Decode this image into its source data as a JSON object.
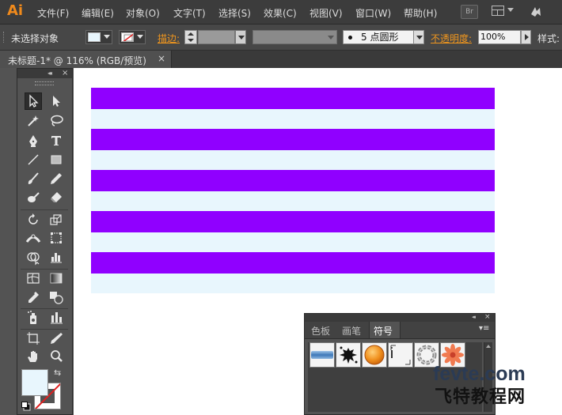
{
  "app": {
    "logo": "Ai"
  },
  "menu": {
    "items": [
      {
        "label": "文件(F)"
      },
      {
        "label": "编辑(E)"
      },
      {
        "label": "对象(O)"
      },
      {
        "label": "文字(T)"
      },
      {
        "label": "选择(S)"
      },
      {
        "label": "效果(C)"
      },
      {
        "label": "视图(V)"
      },
      {
        "label": "窗口(W)"
      },
      {
        "label": "帮助(H)"
      }
    ],
    "bridge_label": "Br",
    "workspace_icon": "workspace-grid-icon",
    "sync_icon": "creative-cloud-sync-icon"
  },
  "control_bar": {
    "selection_label": "未选择对象",
    "fill_color": "#e8f6fd",
    "stroke_icon": "none-stroke-icon",
    "stroke_label": "描边:",
    "brush_label": "5 点圆形",
    "opacity_label": "不透明度:",
    "opacity_value": "100%",
    "style_label": "样式:"
  },
  "document": {
    "tab_title": "未标题-1* @ 116% (RGB/预览)",
    "close": "×"
  },
  "artwork": {
    "stripe_colors": [
      "#9000ff",
      "#e8f6fd"
    ]
  },
  "tools": {
    "collapse": "◂◂",
    "close": "×",
    "fill_color": "#e8f6fd",
    "stroke_color": "none"
  },
  "symbols_panel": {
    "collapse": "◂◂",
    "close": "×",
    "tabs": [
      {
        "label": "色板"
      },
      {
        "label": "画笔"
      },
      {
        "label": "符号"
      }
    ],
    "active_tab": "符号",
    "menu": "▾≡"
  },
  "watermark": {
    "line1": "fevte.com",
    "line2": "飞特教程网"
  },
  "colors": {
    "accent_orange": "#f08a1c",
    "purple": "#9000ff",
    "light_cyan": "#e8f6fd"
  }
}
